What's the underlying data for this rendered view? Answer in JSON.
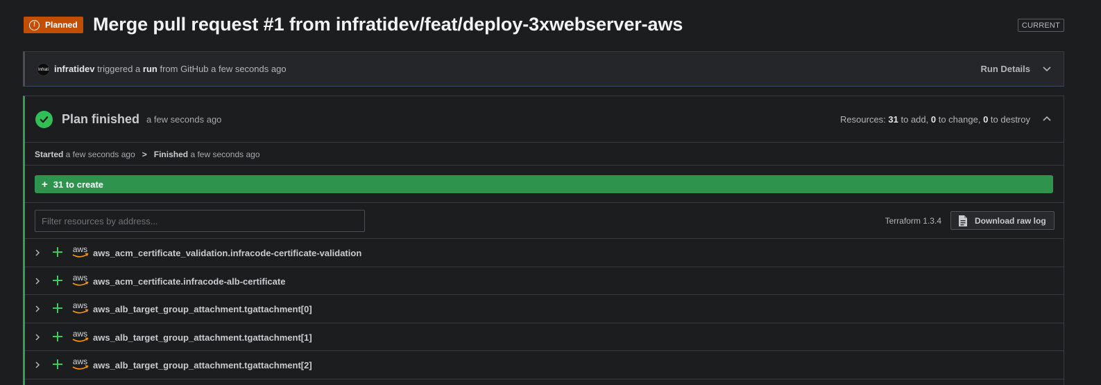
{
  "header": {
    "status_badge": "Planned",
    "title": "Merge pull request #1 from infratidev/feat/deploy-3xwebserver-aws",
    "current_label": "CURRENT"
  },
  "trigger": {
    "avatar_text": "Infrati",
    "user": "infratidev",
    "text_1": " triggered a ",
    "run_word": "run",
    "text_2": " from GitHub a few seconds ago",
    "run_details_label": "Run Details"
  },
  "plan": {
    "title": "Plan finished",
    "ago": "a few seconds ago",
    "resources_label": "Resources: ",
    "add_count": "31",
    "add_text": " to add, ",
    "change_count": "0",
    "change_text": " to change, ",
    "destroy_count": "0",
    "destroy_text": " to destroy",
    "started_label": "Started",
    "started_ago": " a few seconds ago",
    "separator": ">",
    "finished_label": "Finished",
    "finished_ago": " a few seconds ago",
    "create_summary": "31 to create",
    "filter_placeholder": "Filter resources by address...",
    "terraform_version": "Terraform 1.3.4",
    "download_label": "Download raw log"
  },
  "resources": [
    {
      "name": "aws_acm_certificate_validation.infracode-certificate-validation",
      "provider_icon": "aws-icon",
      "action_icon": "plus-icon"
    },
    {
      "name": "aws_acm_certificate.infracode-alb-certificate",
      "provider_icon": "aws-icon",
      "action_icon": "plus-icon"
    },
    {
      "name": "aws_alb_target_group_attachment.tgattachment[0]",
      "provider_icon": "aws-icon",
      "action_icon": "plus-icon"
    },
    {
      "name": "aws_alb_target_group_attachment.tgattachment[1]",
      "provider_icon": "aws-icon",
      "action_icon": "plus-icon"
    },
    {
      "name": "aws_alb_target_group_attachment.tgattachment[2]",
      "provider_icon": "aws-icon",
      "action_icon": "plus-icon"
    }
  ],
  "colors": {
    "planned": "#c24e03",
    "success": "#2fbf56",
    "create_bar": "#2e944d",
    "aws_orange": "#ff9900"
  }
}
